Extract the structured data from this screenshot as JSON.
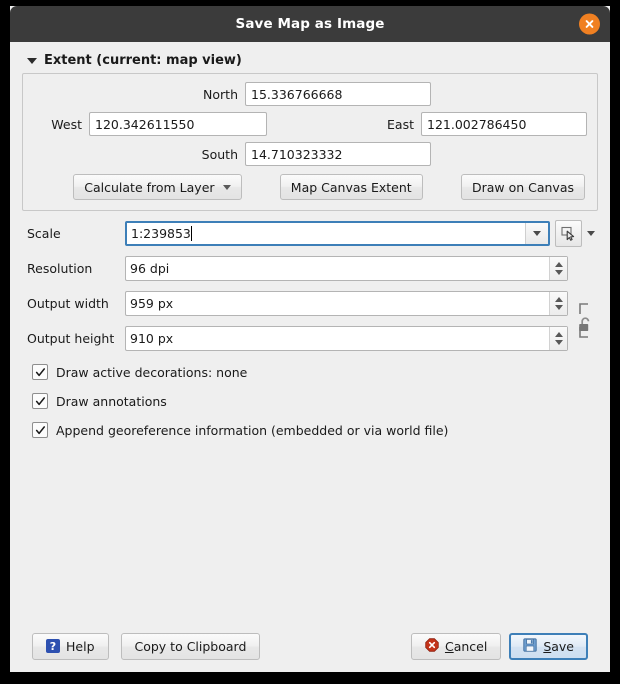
{
  "window": {
    "title": "Save Map as Image",
    "close_icon": "close-icon"
  },
  "extent": {
    "header": "Extent (current: map view)",
    "collapse_icon": "chevron-down-icon",
    "north_label": "North",
    "north_value": "15.336766668",
    "west_label": "West",
    "west_value": "120.342611550",
    "east_label": "East",
    "east_value": "121.002786450",
    "south_label": "South",
    "south_value": "14.710323332",
    "calculate_from_layer": "Calculate from Layer",
    "map_canvas_extent": "Map Canvas Extent",
    "draw_on_canvas": "Draw on Canvas"
  },
  "scale": {
    "label": "Scale",
    "value": "1:239853",
    "dropdown_icon": "chevron-down-icon",
    "picker_icon": "canvas-scale-picker-icon",
    "picker_dropdown_icon": "chevron-down-icon"
  },
  "resolution": {
    "label": "Resolution",
    "value": "96 dpi"
  },
  "output_width": {
    "label": "Output width",
    "value": "959 px"
  },
  "output_height": {
    "label": "Output height",
    "value": "910 px"
  },
  "aspect_lock": {
    "icon": "unlocked-padlock-icon",
    "state": "unlocked"
  },
  "options": [
    {
      "label": "Draw active decorations: none",
      "checked": true
    },
    {
      "label": "Draw annotations",
      "checked": true
    },
    {
      "label": "Append georeference information (embedded or via world file)",
      "checked": true
    }
  ],
  "footer": {
    "help": "Help",
    "help_icon": "help-question-icon",
    "copy_to_clipboard": "Copy to Clipboard",
    "cancel": "Cancel",
    "cancel_icon": "cancel-octagon-icon",
    "save": "Save",
    "save_icon": "floppy-disk-icon"
  },
  "colors": {
    "titlebar": "#3b3b3b",
    "close": "#f08022",
    "accent": "#3d7fb8",
    "body": "#efefef"
  }
}
